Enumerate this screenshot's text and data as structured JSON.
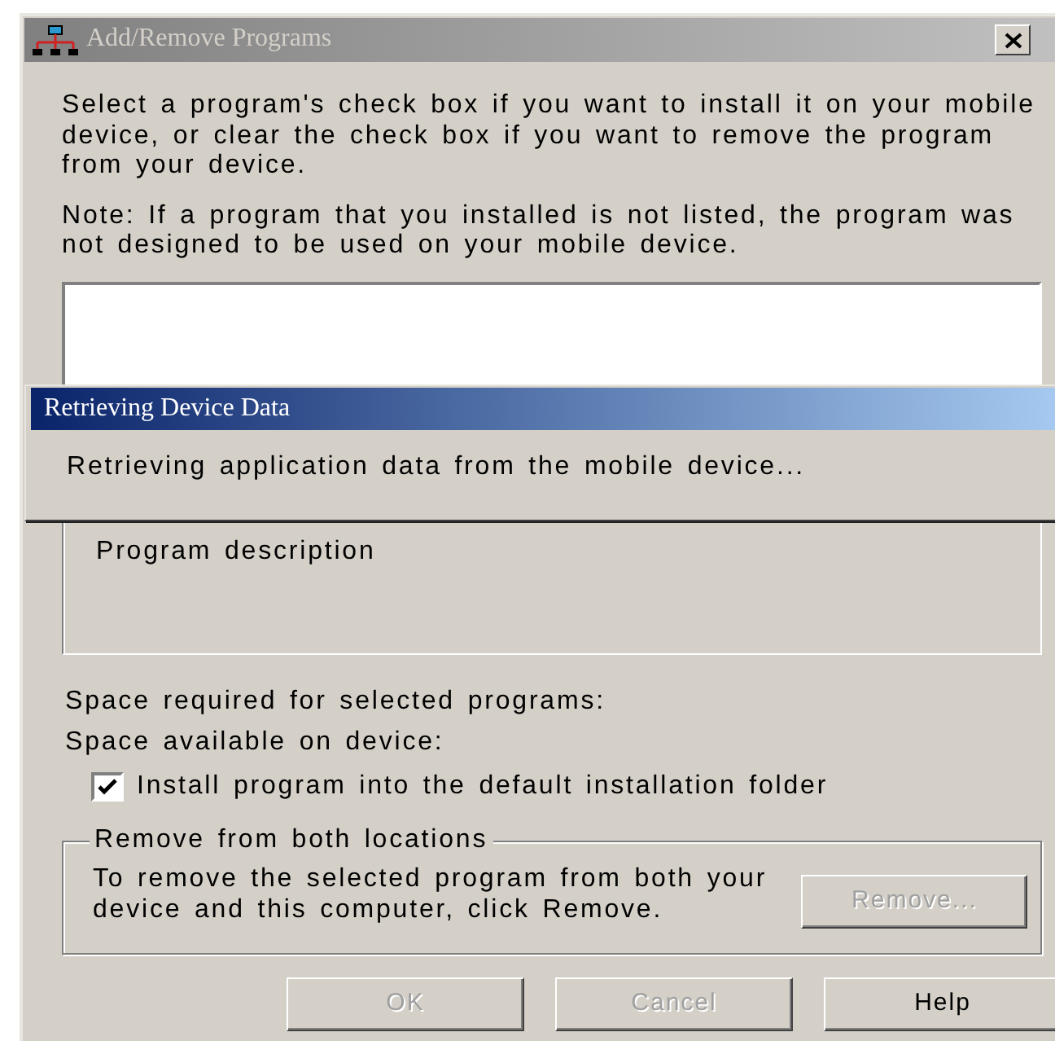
{
  "window": {
    "title": "Add/Remove Programs",
    "active": false
  },
  "instructions": [
    "Select a program's check box if you want to install it on your mobile device, or clear the check box if you want to remove the program from your device.",
    "Note:  If a program that you installed is not listed, the program was not designed to be used on your mobile device."
  ],
  "description": {
    "label": "Program description"
  },
  "space_required": "Space required for selected programs:",
  "space_available": "Space available on device:",
  "install_default": {
    "label": "Install program into the default installation folder",
    "checked": true
  },
  "remove_group": {
    "title": "Remove from both locations",
    "text": "To remove the selected program from both your device and this computer, click Remove.",
    "button": {
      "label": "Remove...",
      "disabled": true
    }
  },
  "buttons": [
    {
      "label": "OK",
      "disabled": true
    },
    {
      "label": "Cancel",
      "disabled": true
    },
    {
      "label": "Help",
      "disabled": false
    }
  ],
  "progress_dialog": {
    "title": "Retrieving Device Data",
    "message": "Retrieving application data from the mobile device...",
    "active": true
  }
}
